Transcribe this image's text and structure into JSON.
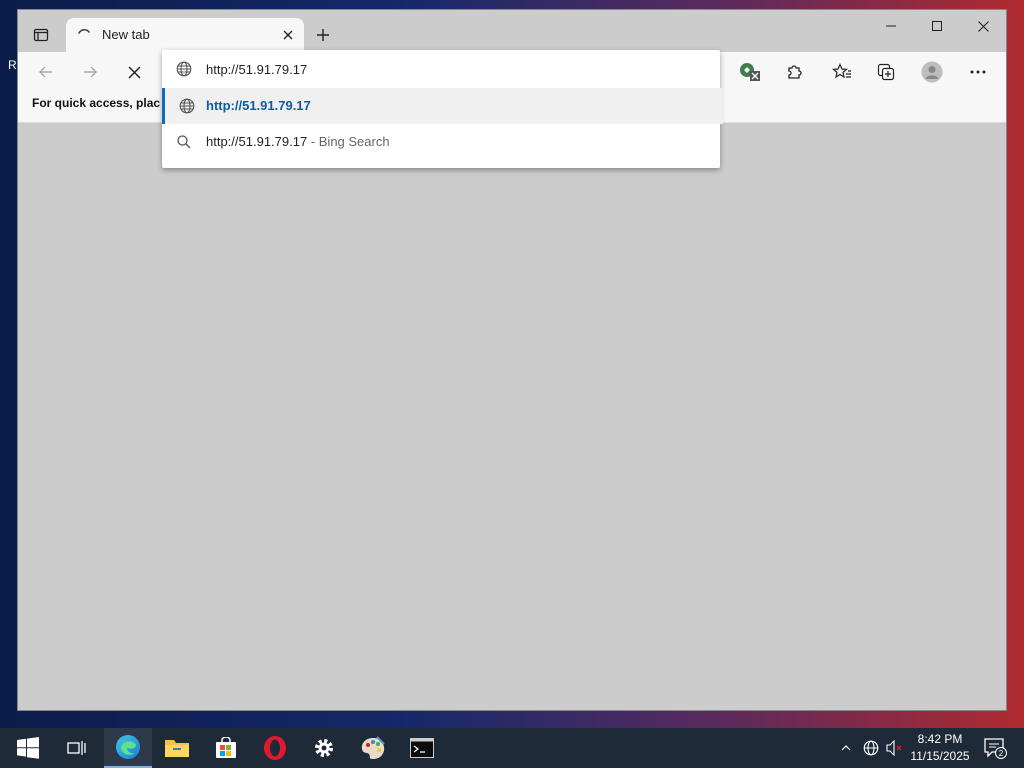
{
  "browser": {
    "tab_title": "New tab",
    "address_value": "http://51.91.79.17",
    "suggestions": [
      {
        "text": "http://51.91.79.17",
        "suffix": ""
      },
      {
        "text": "http://51.91.79.17",
        "suffix": " - Bing Search"
      }
    ],
    "favorites_message": "For quick access, place y"
  },
  "taskbar": {
    "time": "8:42 PM",
    "date": "11/15/2025",
    "notifications": "2"
  },
  "colors": {
    "accent": "#0f6cbd",
    "taskbar_bg": "#1f2a38",
    "browser_bg": "#cccccc"
  }
}
